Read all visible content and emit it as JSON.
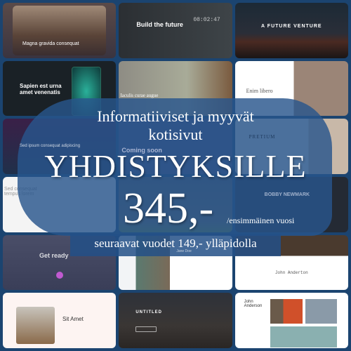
{
  "thumbnails": [
    {
      "title": "Magna gravida consequat"
    },
    {
      "title": "Build the future",
      "clock": "08:02:47"
    },
    {
      "title": "A FUTURE VENTURE"
    },
    {
      "title": "Sapien est urna amet venenatis"
    },
    {
      "title": "Iaculis curae augue"
    },
    {
      "title": "Enim libero"
    },
    {
      "title": "Sed ipsum consequat adipiscing"
    },
    {
      "title": "Coming soon"
    },
    {
      "title": "PRETIUM"
    },
    {
      "title": "Sed consequat tempus lorem"
    },
    {
      "title": ""
    },
    {
      "title": "BOBBY NEWMARK"
    },
    {
      "title": "Get ready"
    },
    {
      "title": "Jane Doe"
    },
    {
      "title": "John Anderton"
    },
    {
      "title": "Sit Amet"
    },
    {
      "title": "UNTITLED"
    },
    {
      "title": "John Anderson"
    }
  ],
  "overlay": {
    "subtitle": "Informatiiviset ja myyvät kotisivut",
    "headline": "YHDISTYKSILLE",
    "price": "345,-",
    "price_note": "/ensimmäinen vuosi",
    "footer": "seuraavat vuodet 149,- ylläpidolla"
  },
  "colors": {
    "background": "#1b4470",
    "overlay": "#28558c"
  }
}
